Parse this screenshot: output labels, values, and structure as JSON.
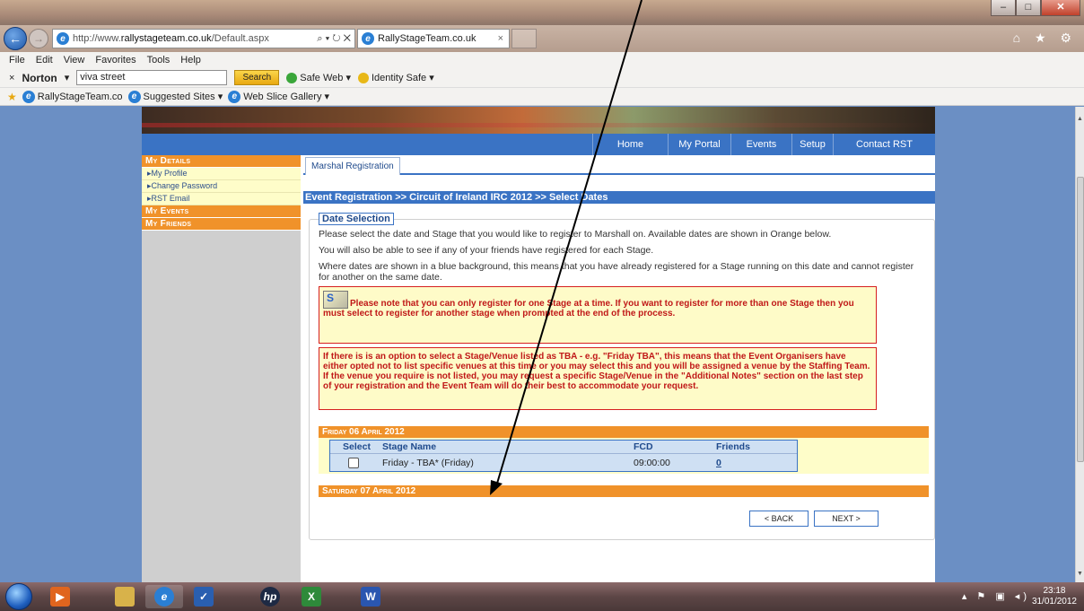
{
  "browser": {
    "url_prefix": "http://www.",
    "url_domain": "rallystageteam.co.uk",
    "url_path": "/Default.aspx",
    "addr_controls": "⌕ ▾ ↻ ✕",
    "tab_title": "RallyStageTeam.co.uk",
    "tab_close": "×",
    "menu": [
      "File",
      "Edit",
      "View",
      "Favorites",
      "Tools",
      "Help"
    ],
    "norton_close": "×",
    "norton_label": "Norton",
    "search_value": "viva street",
    "search_button": "Search",
    "safe_web": "Safe Web ▾",
    "identity_safe": "Identity Safe ▾",
    "favorites": [
      "RallyStageTeam.co",
      "Suggested Sites ▾",
      "Web Slice Gallery ▾"
    ],
    "right_icons": "⌂ ★ ⚙"
  },
  "site": {
    "nav": [
      "Home",
      "My Portal",
      "Events",
      "Setup",
      "Contact RST"
    ],
    "sidebar": {
      "my_details": "My Details",
      "detail_items": [
        "My Profile",
        "Change Password",
        "RST Email"
      ],
      "my_events": "My Events",
      "my_friends": "My Friends"
    },
    "tab_label": "Marshal Registration",
    "breadcrumb": "Event Registration >> Circuit of Ireland IRC 2012 >> Select Dates",
    "section_title": "Date Selection",
    "para1": "Please select the date and Stage that you would like to register to Marshall on.  Available dates are shown in Orange below.",
    "para2": "You will also be able to see if any of your friends have registered for each Stage.",
    "para3": "Where dates are shown in a blue background, this means that you have already registered for a Stage running on this date and cannot register for another on the same date.",
    "notice1": "Please note that you can only register for one Stage at a time.  If you want to register for more than one Stage then you must select to register for another stage when prompted at the end of the process.",
    "notice2": "If there is is an option to select a Stage/Venue listed as TBA - e.g. \"Friday TBA\", this means that the Event Organisers have either opted not to list specific venues at this time or you may select this and you will be assigned a venue by the Staffing Team. If the venue you require is not listed, you may request a specific Stage/Venue in the \"Additional Notes\" section on the last step of your registration and the Event Team will do their best to accommodate your request.",
    "day1": "Friday 06 April 2012",
    "columns": [
      "Select",
      "Stage Name",
      "FCD",
      "Friends"
    ],
    "row": {
      "stage": "Friday - TBA* (Friday)",
      "fcd": "09:00:00",
      "friends": "0"
    },
    "day2": "Saturday 07 April 2012",
    "back_button": "< BACK",
    "next_button": "NEXT >"
  },
  "taskbar": {
    "time": "23:18",
    "date": "31/01/2012",
    "tray": "▴ ⚑ ▣ ◂)"
  },
  "colors": {
    "accent_blue": "#3a73c4",
    "orange": "#f0922a",
    "notice_red": "#c01818",
    "notice_bg": "#fefbc8"
  }
}
